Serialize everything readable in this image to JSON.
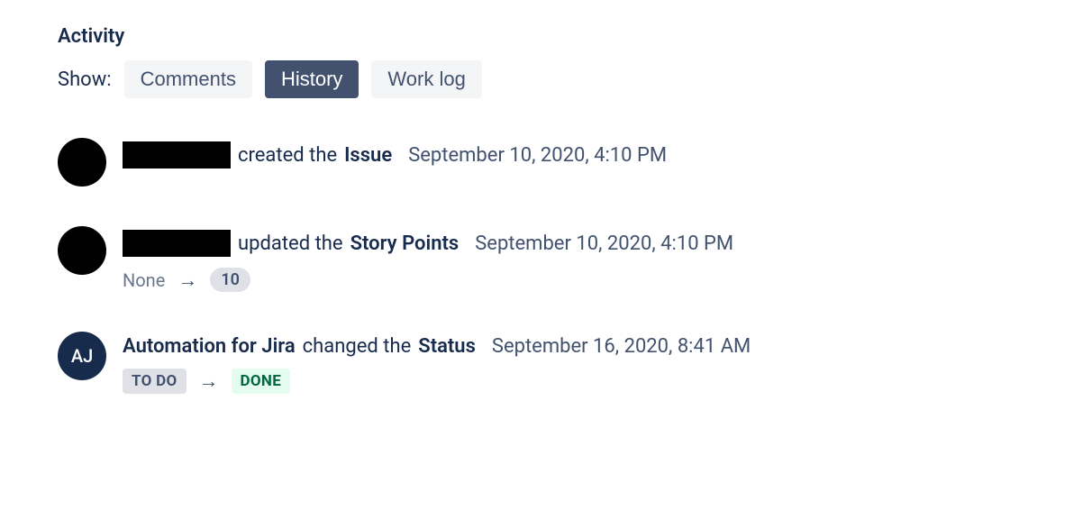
{
  "section": {
    "title": "Activity"
  },
  "showRow": {
    "label": "Show:",
    "tabs": [
      {
        "label": "Comments",
        "active": false
      },
      {
        "label": "History",
        "active": true
      },
      {
        "label": "Work log",
        "active": false
      }
    ]
  },
  "entries": [
    {
      "actor": {
        "type": "redacted",
        "initials": "",
        "avatarColor": "black"
      },
      "verb": "created the",
      "object": "Issue",
      "timestamp": "September 10, 2020, 4:10 PM",
      "change": null
    },
    {
      "actor": {
        "type": "redacted",
        "initials": "",
        "avatarColor": "black"
      },
      "verb": "updated the",
      "object": "Story Points",
      "timestamp": "September 10, 2020, 4:10 PM",
      "change": {
        "from": {
          "kind": "none",
          "text": "None"
        },
        "to": {
          "kind": "pill",
          "text": "10"
        }
      }
    },
    {
      "actor": {
        "type": "named",
        "name": "Automation for Jira",
        "initials": "AJ",
        "avatarColor": "navy"
      },
      "verb": "changed the",
      "object": "Status",
      "timestamp": "September 16, 2020, 8:41 AM",
      "change": {
        "from": {
          "kind": "lozenge",
          "text": "TO DO"
        },
        "to": {
          "kind": "lozenge-done",
          "text": "DONE"
        }
      }
    }
  ]
}
